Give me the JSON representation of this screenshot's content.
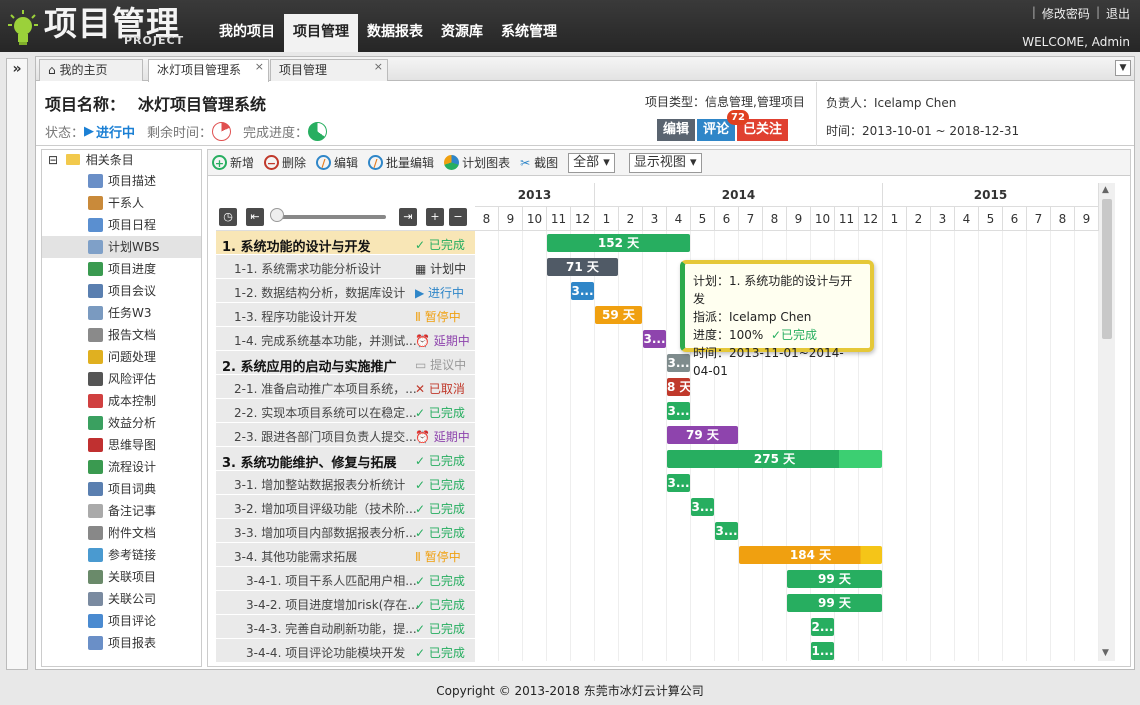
{
  "logo": {
    "text": "项目管理",
    "sub": "PROJECT"
  },
  "nav": [
    "我的项目",
    "项目管理",
    "数据报表",
    "资源库",
    "系统管理"
  ],
  "top_links": {
    "change_pwd": "修改密码",
    "logout": "退出",
    "welcome": "WELCOME, Admin"
  },
  "tabs": [
    {
      "label": "我的主页"
    },
    {
      "label": "冰灯项目管理系"
    },
    {
      "label": "项目管理"
    }
  ],
  "project": {
    "name_label": "项目名称：",
    "name": "冰灯项目管理系统",
    "status_label": "状态：",
    "status": "进行中",
    "remain_label": "剩余时间：",
    "progress_label": "完成进度：",
    "type": "项目类型：信息管理,管理项目",
    "edit": "编辑",
    "comment": "评论",
    "comment_count": "72",
    "follow": "已关注",
    "owner": "负责人：Icelamp Chen",
    "time": "时间：2013-10-01 ~ 2018-12-31"
  },
  "tree": {
    "root": "相关条目",
    "items": [
      "项目描述",
      "干系人",
      "项目日程",
      "计划WBS",
      "项目进度",
      "项目会议",
      "任务W3",
      "报告文档",
      "问题处理",
      "风险评估",
      "成本控制",
      "效益分析",
      "思维导图",
      "流程设计",
      "项目词典",
      "备注记事",
      "附件文档",
      "参考链接",
      "关联项目",
      "关联公司",
      "项目评论",
      "项目报表"
    ],
    "selected": 3
  },
  "toolbar": {
    "add": "新增",
    "del": "删除",
    "edit": "编辑",
    "batch": "批量编辑",
    "chart": "计划图表",
    "shot": "截图",
    "filter": "全部",
    "view": "显示视图"
  },
  "years": [
    "2013",
    "2014",
    "2015"
  ],
  "months": [
    "8",
    "9",
    "10",
    "11",
    "12",
    "1",
    "2",
    "3",
    "4",
    "5",
    "6",
    "7",
    "8",
    "9",
    "10",
    "11",
    "12",
    "1",
    "2",
    "3",
    "4",
    "5",
    "6",
    "7",
    "8",
    "9"
  ],
  "rows": [
    {
      "name": "1. 系统功能的设计与开发",
      "status": "已完成",
      "bar": "152 天"
    },
    {
      "name": "1-1. 系统需求功能分析设计",
      "status": "计划中",
      "bar": "71 天"
    },
    {
      "name": "1-2. 数据结构分析，数据库设计",
      "status": "进行中",
      "bar": "3..."
    },
    {
      "name": "1-3. 程序功能设计开发",
      "status": "暂停中",
      "bar": "59 天"
    },
    {
      "name": "1-4. 完成系统基本功能，并测试...",
      "status": "延期中",
      "bar": "3..."
    },
    {
      "name": "2. 系统应用的启动与实施推广",
      "status": "提议中",
      "bar": "3..."
    },
    {
      "name": "2-1. 准备启动推广本项目系统，...",
      "status": "已取消",
      "bar": "8 天"
    },
    {
      "name": "2-2. 实现本项目系统可以在稳定...",
      "status": "已完成",
      "bar": "3..."
    },
    {
      "name": "2-3. 跟进各部门项目负责人提交...",
      "status": "延期中",
      "bar": "79 天"
    },
    {
      "name": "3. 系统功能维护、修复与拓展",
      "status": "已完成",
      "bar": "275 天"
    },
    {
      "name": "3-1. 增加整站数据报表分析统计",
      "status": "已完成",
      "bar": "3..."
    },
    {
      "name": "3-2. 增加项目评级功能（技术阶...",
      "status": "已完成",
      "bar": "3..."
    },
    {
      "name": "3-3. 增加项目内部数据报表分析...",
      "status": "已完成",
      "bar": "3..."
    },
    {
      "name": "3-4. 其他功能需求拓展",
      "status": "暂停中",
      "bar": "184 天"
    },
    {
      "name": "3-4-1. 项目干系人匹配用户相...",
      "status": "已完成",
      "bar": "99 天"
    },
    {
      "name": "3-4-2. 项目进度增加risk(存在...",
      "status": "已完成",
      "bar": "99 天"
    },
    {
      "name": "3-4-3. 完善自动刷新功能，提...",
      "status": "已完成",
      "bar": "2..."
    },
    {
      "name": "3-4-4. 项目评论功能模块开发",
      "status": "已完成",
      "bar": "1..."
    }
  ],
  "tooltip": {
    "plan": "计划：1. 系统功能的设计与开发",
    "assign": "指派：Icelamp Chen",
    "progress": "进度：100%",
    "progress_status": "已完成",
    "time": "时间：2013-11-01~2014-04-01"
  },
  "footer": "Copyright © 2013-2018 东莞市冰灯云计算公司",
  "colors": {
    "green": "#27ae60",
    "blue": "#2f86c8",
    "orange": "#f0a010",
    "purple": "#8e44ad",
    "gray": "#7f8c8d",
    "red": "#c0392b",
    "dark": "#505a66"
  }
}
